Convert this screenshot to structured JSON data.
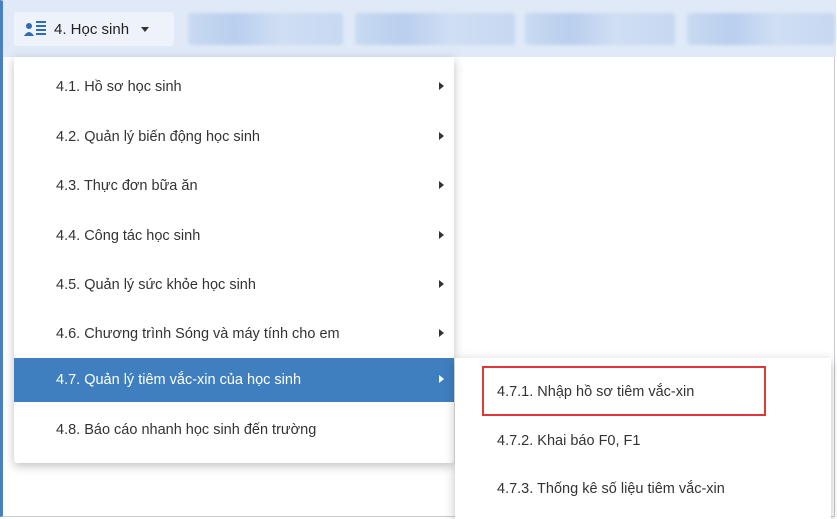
{
  "menu_button": {
    "label": "4. Học sinh",
    "icon": "user-list-icon"
  },
  "dropdown": {
    "items": [
      {
        "label": "4.1. Hồ sơ học sinh"
      },
      {
        "label": "4.2. Quản lý biến động học sinh"
      },
      {
        "label": "4.3. Thực đơn bữa ăn"
      },
      {
        "label": "4.4. Công tác học sinh"
      },
      {
        "label": "4.5. Quản lý sức khỏe học sinh"
      },
      {
        "label": "4.6. Chương trình Sóng và máy tính cho em"
      },
      {
        "label": "4.7. Quản lý tiêm vắc-xin của học sinh"
      },
      {
        "label": "4.8. Báo cáo nhanh học sinh đến trường"
      }
    ],
    "active_index": 6
  },
  "submenu": {
    "items": [
      {
        "label": "4.7.1. Nhập hồ sơ tiêm vắc-xin"
      },
      {
        "label": "4.7.2. Khai báo F0, F1"
      },
      {
        "label": "4.7.3. Thống kê số liệu tiêm vắc-xin"
      }
    ]
  },
  "colors": {
    "active_bg": "#3f7fbf",
    "highlight_border": "#e03838",
    "topbar_bg": "#dfe9f7"
  }
}
